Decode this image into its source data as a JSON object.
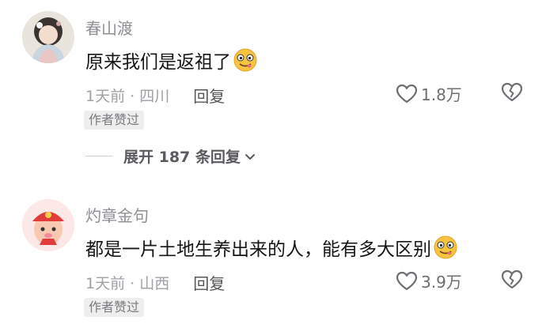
{
  "comments": [
    {
      "username": "春山渡",
      "content": "原来我们是返祖了",
      "emoji": "drooling-face-emoji",
      "time_location": "1天前 · 四川",
      "reply_label": "回复",
      "like_count": "1.8万",
      "badge": "作者赞过"
    },
    {
      "username": "灼章金句",
      "content": "都是一片土地生养出来的人，能有多大区别",
      "emoji": "drooling-face-emoji",
      "time_location": "1天前 · 山西",
      "reply_label": "回复",
      "like_count": "3.9万",
      "badge": "作者赞过"
    }
  ],
  "expand_replies": {
    "label": "展开 187 条回复"
  },
  "colors": {
    "username": "#8e8e93",
    "meta": "#a0a0a5",
    "badge_bg": "#eeeeee",
    "emoji": "#f6c441"
  }
}
